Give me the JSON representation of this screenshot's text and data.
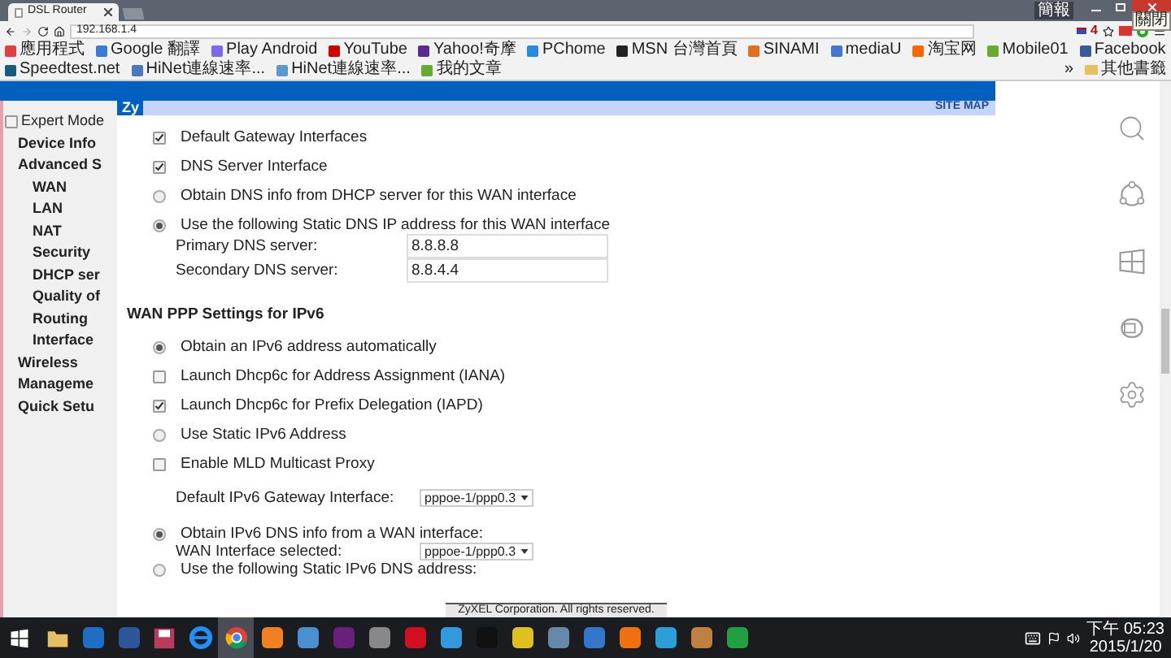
{
  "browser": {
    "tab_title": "DSL Router",
    "profile_label": "簡報",
    "close_tooltip": "關閉",
    "url": "192.168.1.4",
    "extension_badge": "4",
    "bookmarks": [
      {
        "label": "應用程式"
      },
      {
        "label": "Google 翻譯"
      },
      {
        "label": "Play Android"
      },
      {
        "label": "YouTube"
      },
      {
        "label": "Yahoo!奇摩"
      },
      {
        "label": "PChome"
      },
      {
        "label": "MSN 台灣首頁"
      },
      {
        "label": "SINAMI"
      },
      {
        "label": "mediaU"
      },
      {
        "label": "淘宝网"
      },
      {
        "label": "Mobile01"
      },
      {
        "label": "Facebook"
      },
      {
        "label": "Speedtest.net"
      },
      {
        "label": "HiNet連線速率..."
      },
      {
        "label": "HiNet連線速率..."
      },
      {
        "label": "我的文章"
      }
    ],
    "bookmarks_more": "»",
    "other_bookmarks": "其他書籤"
  },
  "page": {
    "logo": "Zy",
    "site_map": "SITE MAP",
    "sidebar": {
      "expert_mode": {
        "label": "Expert Mode",
        "checked": false
      },
      "items": [
        {
          "label": "Device Info"
        },
        {
          "label": "Advanced S",
          "children": [
            {
              "label": "WAN"
            },
            {
              "label": "LAN"
            },
            {
              "label": "NAT"
            },
            {
              "label": "Security"
            },
            {
              "label": "DHCP ser"
            },
            {
              "label": "Quality of"
            },
            {
              "label": "Routing"
            },
            {
              "label": "Interface"
            }
          ]
        },
        {
          "label": "Wireless"
        },
        {
          "label": "Manageme"
        },
        {
          "label": "Quick Setu"
        }
      ]
    },
    "form": [
      {
        "kind": "checkbox",
        "label": "Default Gateway Interfaces",
        "checked": true
      },
      {
        "kind": "checkbox",
        "label": "DNS Server Interface",
        "checked": true
      },
      {
        "kind": "radio",
        "label": "Obtain DNS info from DHCP server for this WAN interface",
        "selected": false
      },
      {
        "kind": "radio",
        "label": "Use the following Static DNS IP address for this WAN interface",
        "selected": true
      },
      {
        "kind": "fields",
        "rows": [
          {
            "label": "Primary DNS server:",
            "value": "8.8.8.8"
          },
          {
            "label": "Secondary DNS server:",
            "value": "8.8.4.4"
          }
        ]
      },
      {
        "kind": "heading",
        "label": "WAN PPP Settings for IPv6"
      },
      {
        "kind": "radio",
        "label": "Obtain an IPv6 address automatically",
        "selected": true
      },
      {
        "kind": "checkbox",
        "label": "Launch Dhcp6c for Address Assignment (IANA)",
        "checked": false
      },
      {
        "kind": "checkbox",
        "label": "Launch Dhcp6c for Prefix Delegation (IAPD)",
        "checked": true
      },
      {
        "kind": "radio",
        "label": "Use Static IPv6 Address",
        "selected": false
      },
      {
        "kind": "checkbox",
        "label": "Enable MLD Multicast Proxy",
        "checked": false
      },
      {
        "kind": "select",
        "label": "Default IPv6 Gateway Interface:",
        "value": "pppoe-1/ppp0.3"
      },
      {
        "kind": "radio",
        "label": "Obtain IPv6 DNS info from a WAN interface:",
        "selected": true
      },
      {
        "kind": "select",
        "label": "WAN Interface selected:",
        "value": "pppoe-1/ppp0.3"
      },
      {
        "kind": "radio",
        "label": "Use the following Static IPv6 DNS address:",
        "selected": false
      }
    ],
    "footer": "ZyXEL Corporation. All rights reserved."
  },
  "taskbar": {
    "apps": [
      {
        "selected": false
      },
      {
        "selected": false
      },
      {
        "selected": false
      },
      {
        "selected": false
      },
      {
        "selected": false
      },
      {
        "selected": true
      },
      {
        "selected": false
      },
      {
        "selected": false
      },
      {
        "selected": false
      },
      {
        "selected": false
      },
      {
        "selected": false
      },
      {
        "selected": false
      },
      {
        "selected": false
      },
      {
        "selected": false
      },
      {
        "selected": false
      },
      {
        "selected": false
      },
      {
        "selected": false
      },
      {
        "selected": false
      },
      {
        "selected": false
      },
      {
        "selected": false
      }
    ],
    "time": "下午 05:23",
    "date": "2015/1/20"
  }
}
